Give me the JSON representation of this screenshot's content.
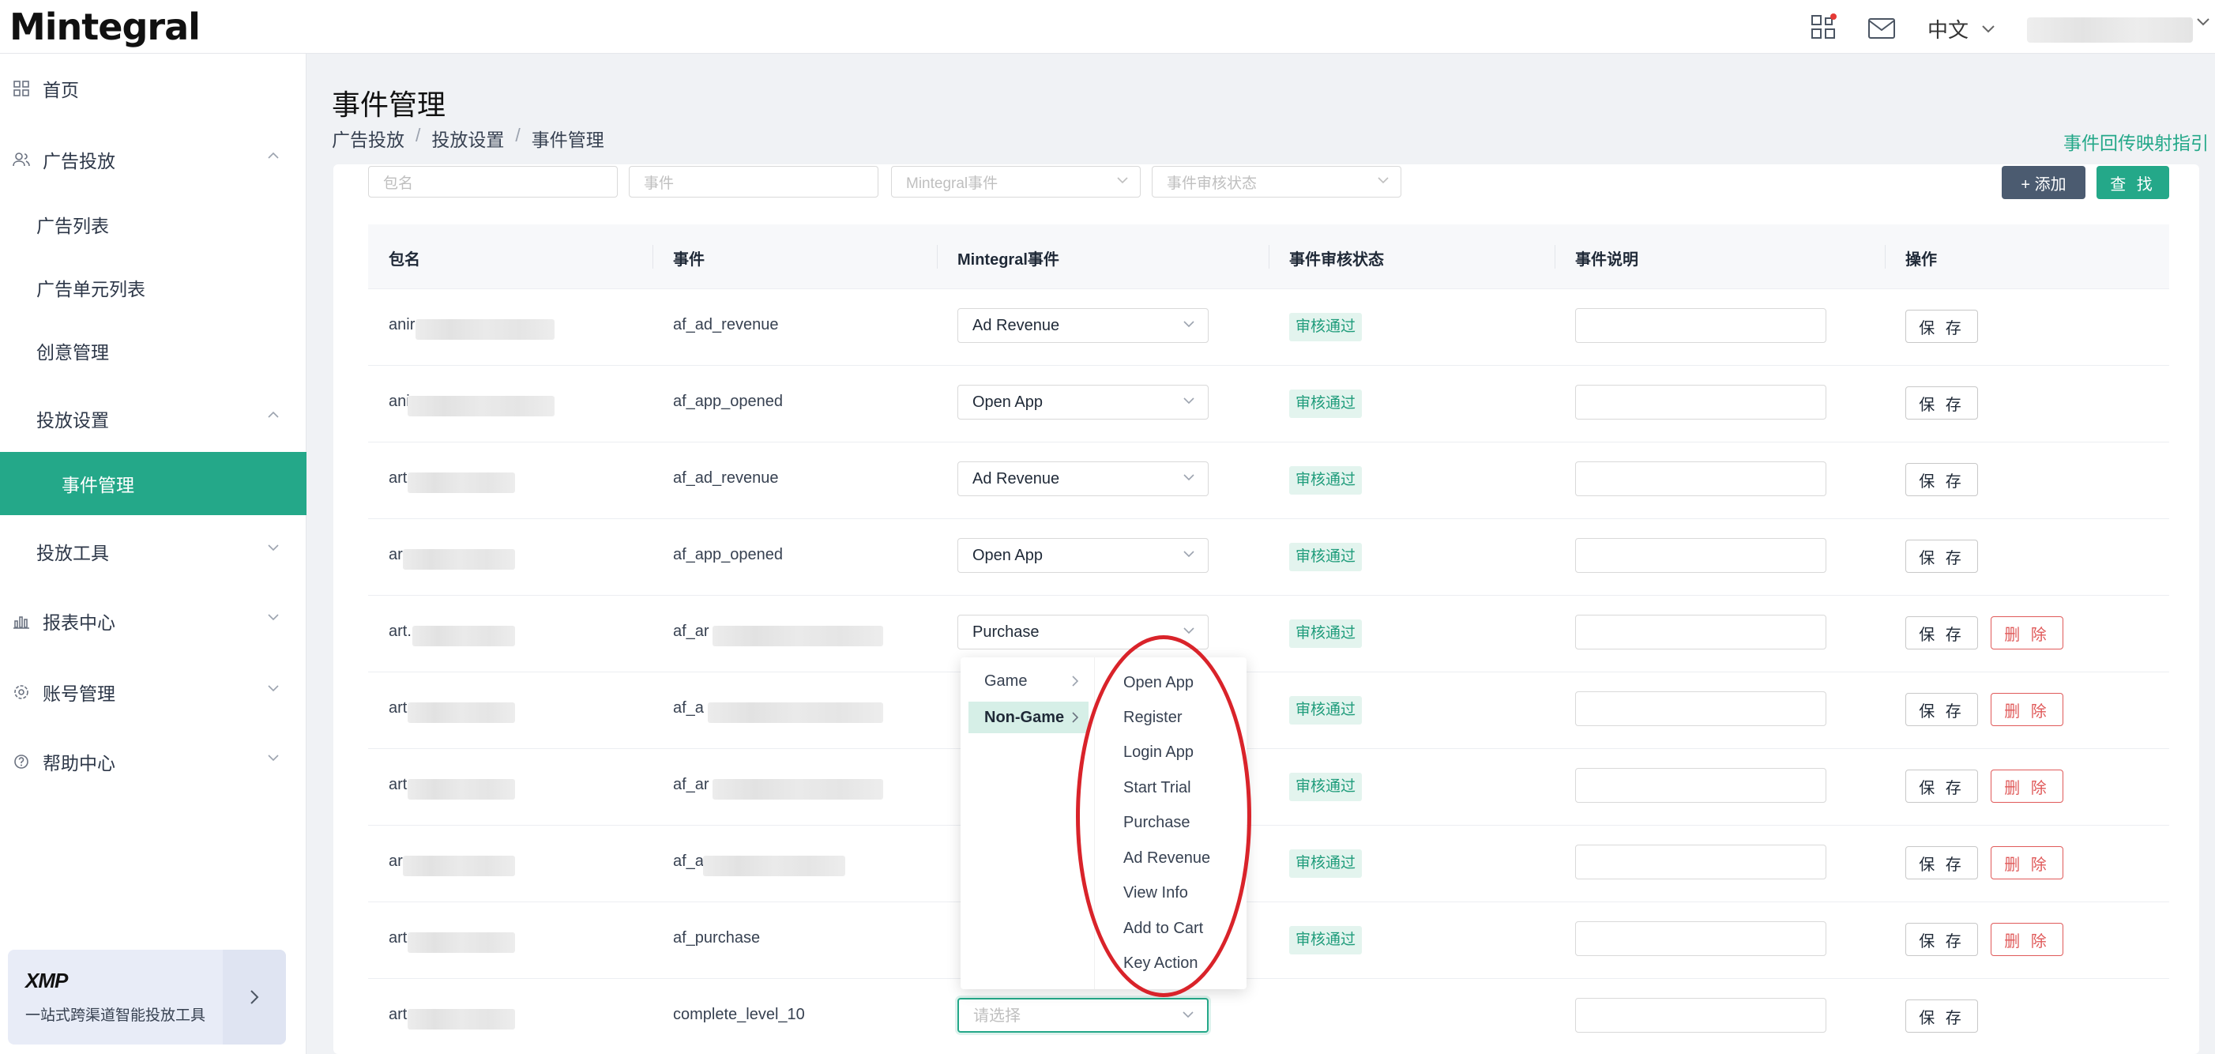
{
  "app": {
    "logo": "Mintegral",
    "language": "中文"
  },
  "sidebar": {
    "home": "首页",
    "ads": "广告投放",
    "ad_list": "广告列表",
    "ad_unit_list": "广告单元列表",
    "creative": "创意管理",
    "delivery_settings": "投放设置",
    "event_mgmt": "事件管理",
    "delivery_tools": "投放工具",
    "report_center": "报表中心",
    "account_mgmt": "账号管理",
    "help_center": "帮助中心",
    "xmp_logo": "XMP",
    "xmp_text": "一站式跨渠道智能投放工具"
  },
  "page": {
    "title": "事件管理",
    "breadcrumb": [
      "广告投放",
      "投放设置",
      "事件管理"
    ],
    "guide_link": "事件回传映射指引"
  },
  "filters": {
    "package_placeholder": "包名",
    "event_placeholder": "事件",
    "mintegral_event_placeholder": "Mintegral事件",
    "review_status_placeholder": "事件审核状态",
    "add_label": "+ 添加",
    "find_label": "查 找"
  },
  "table": {
    "columns": [
      "包名",
      "事件",
      "Mintegral事件",
      "事件审核状态",
      "事件说明",
      "操作"
    ],
    "save_label": "保 存",
    "delete_label": "删 除",
    "rows": [
      {
        "pkg": "anir",
        "event": "af_ad_revenue",
        "mtg_event": "Ad Revenue",
        "status": "审核通过",
        "deletable": false
      },
      {
        "pkg": "ani",
        "event": "af_app_opened",
        "mtg_event": "Open App",
        "status": "审核通过",
        "deletable": false
      },
      {
        "pkg": "art",
        "event": "af_ad_revenue",
        "mtg_event": "Ad Revenue",
        "status": "审核通过",
        "deletable": false
      },
      {
        "pkg": "ar",
        "event": "af_app_opened",
        "mtg_event": "Open App",
        "status": "审核通过",
        "deletable": false
      },
      {
        "pkg": "art.",
        "event": "af_ar",
        "mtg_event": "Purchase",
        "status": "审核通过",
        "deletable": true
      },
      {
        "pkg": "art",
        "event": "af_a",
        "mtg_event": "",
        "status": "审核通过",
        "deletable": true
      },
      {
        "pkg": "art",
        "event": "af_ar",
        "mtg_event": "",
        "status": "审核通过",
        "deletable": true
      },
      {
        "pkg": "ar",
        "event": "af_a",
        "mtg_event": "",
        "status": "审核通过",
        "deletable": true
      },
      {
        "pkg": "art",
        "event": "af_purchase",
        "mtg_event": "",
        "status": "审核通过",
        "deletable": true
      },
      {
        "pkg": "art",
        "event": "complete_level_10",
        "mtg_event": "",
        "status": "",
        "deletable": false
      }
    ],
    "select_placeholder": "请选择"
  },
  "cascader": {
    "categories": [
      "Game",
      "Non-Game"
    ],
    "selected_category": "Non-Game",
    "options": [
      "Open App",
      "Register",
      "Login App",
      "Start Trial",
      "Purchase",
      "Ad Revenue",
      "View Info",
      "Add to Cart",
      "Key Action"
    ]
  },
  "colors": {
    "accent": "#24a889",
    "danger": "#e05a5a",
    "annotation": "#d9232a"
  }
}
